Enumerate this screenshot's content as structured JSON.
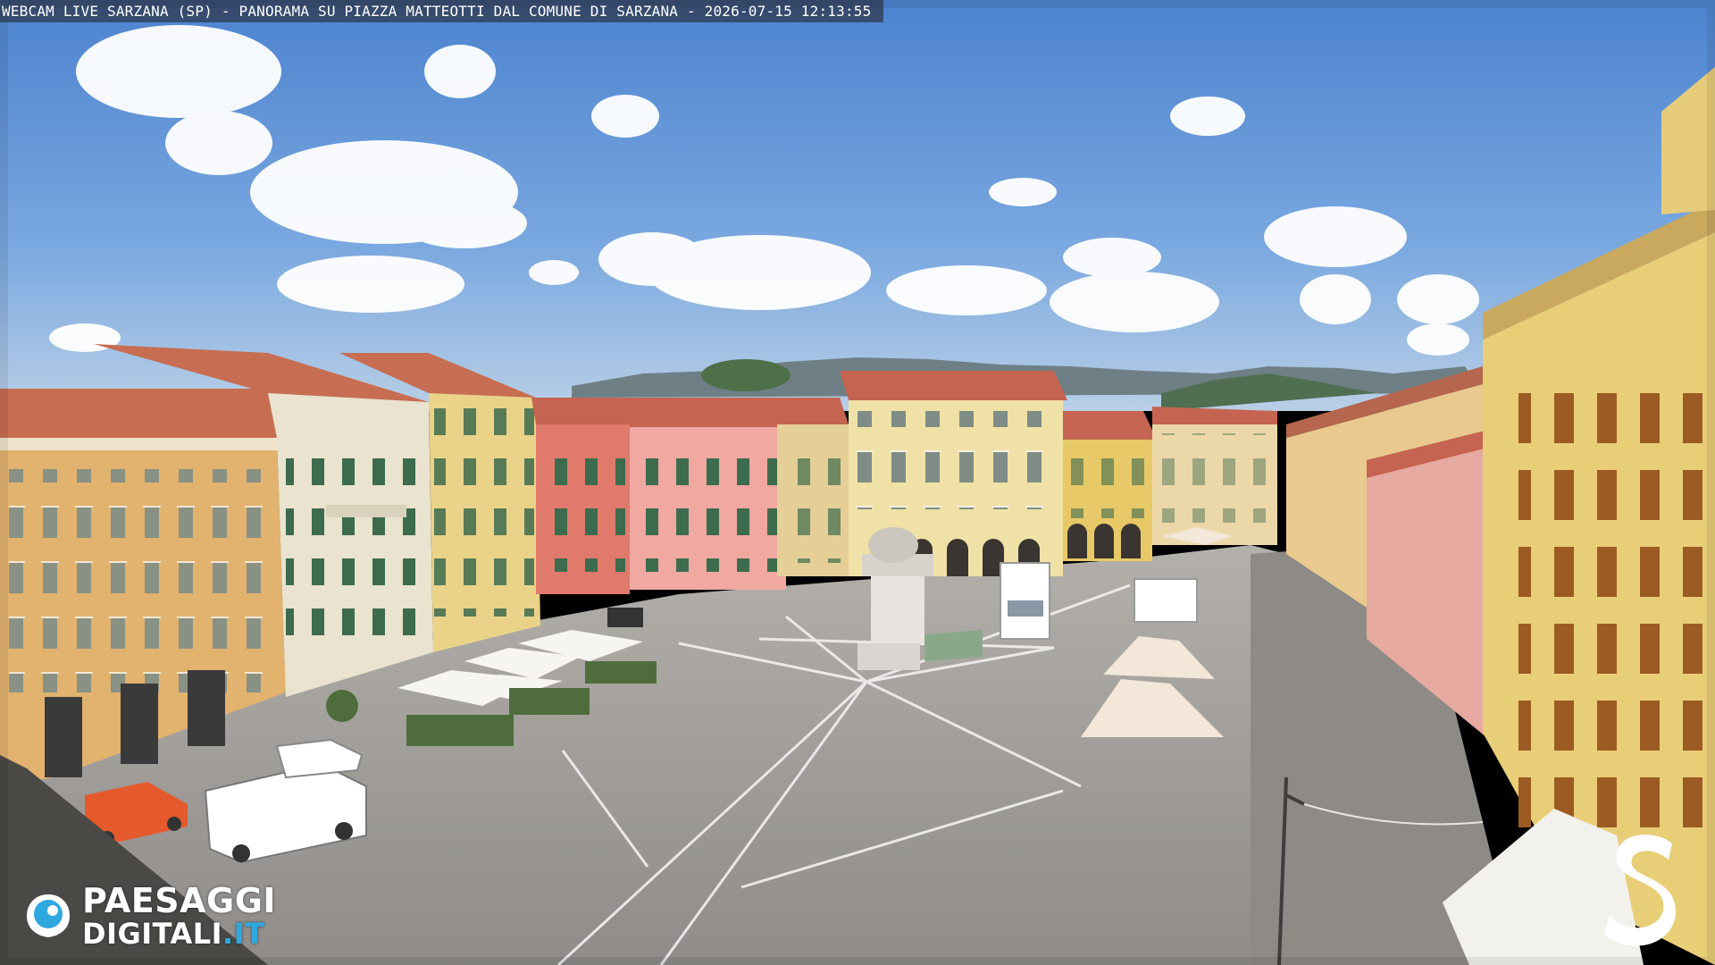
{
  "webcam": {
    "caption": "WEBCAM LIVE SARZANA (SP) - PANORAMA SU PIAZZA MATTEOTTI DAL COMUNE DI SARZANA - 2026-07-15  12:13:55"
  },
  "logo": {
    "line1": "PAESAGGI",
    "line2_prefix": "DIGITALI",
    "line2_suffix": ".IT",
    "accent_color": "#2fa8e0",
    "icon": "camera-eye-icon"
  },
  "corner_mark": {
    "icon": "s-monogram-icon",
    "color": "#ffffff"
  },
  "scene": {
    "sky_color": "#5f94d8",
    "pavement_color": "#a4a2a0",
    "building_colors": [
      "#e2b26f",
      "#eae3cf",
      "#ead389",
      "#e58778",
      "#f0a8a1",
      "#f0e2a6",
      "#e8c968"
    ]
  }
}
